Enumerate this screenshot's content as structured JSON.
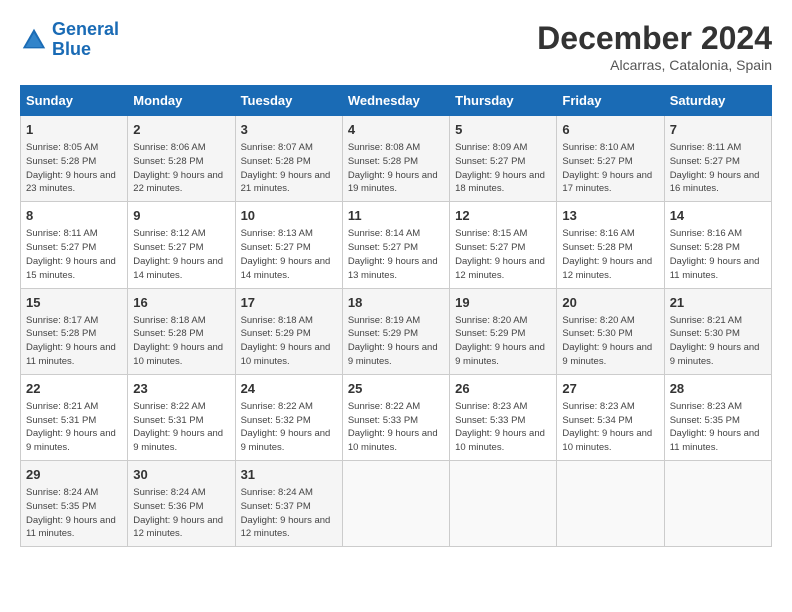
{
  "header": {
    "logo_line1": "General",
    "logo_line2": "Blue",
    "month_year": "December 2024",
    "location": "Alcarras, Catalonia, Spain"
  },
  "days_of_week": [
    "Sunday",
    "Monday",
    "Tuesday",
    "Wednesday",
    "Thursday",
    "Friday",
    "Saturday"
  ],
  "weeks": [
    [
      {
        "day": "1",
        "sunrise": "Sunrise: 8:05 AM",
        "sunset": "Sunset: 5:28 PM",
        "daylight": "Daylight: 9 hours and 23 minutes."
      },
      {
        "day": "2",
        "sunrise": "Sunrise: 8:06 AM",
        "sunset": "Sunset: 5:28 PM",
        "daylight": "Daylight: 9 hours and 22 minutes."
      },
      {
        "day": "3",
        "sunrise": "Sunrise: 8:07 AM",
        "sunset": "Sunset: 5:28 PM",
        "daylight": "Daylight: 9 hours and 21 minutes."
      },
      {
        "day": "4",
        "sunrise": "Sunrise: 8:08 AM",
        "sunset": "Sunset: 5:28 PM",
        "daylight": "Daylight: 9 hours and 19 minutes."
      },
      {
        "day": "5",
        "sunrise": "Sunrise: 8:09 AM",
        "sunset": "Sunset: 5:27 PM",
        "daylight": "Daylight: 9 hours and 18 minutes."
      },
      {
        "day": "6",
        "sunrise": "Sunrise: 8:10 AM",
        "sunset": "Sunset: 5:27 PM",
        "daylight": "Daylight: 9 hours and 17 minutes."
      },
      {
        "day": "7",
        "sunrise": "Sunrise: 8:11 AM",
        "sunset": "Sunset: 5:27 PM",
        "daylight": "Daylight: 9 hours and 16 minutes."
      }
    ],
    [
      {
        "day": "8",
        "sunrise": "Sunrise: 8:11 AM",
        "sunset": "Sunset: 5:27 PM",
        "daylight": "Daylight: 9 hours and 15 minutes."
      },
      {
        "day": "9",
        "sunrise": "Sunrise: 8:12 AM",
        "sunset": "Sunset: 5:27 PM",
        "daylight": "Daylight: 9 hours and 14 minutes."
      },
      {
        "day": "10",
        "sunrise": "Sunrise: 8:13 AM",
        "sunset": "Sunset: 5:27 PM",
        "daylight": "Daylight: 9 hours and 14 minutes."
      },
      {
        "day": "11",
        "sunrise": "Sunrise: 8:14 AM",
        "sunset": "Sunset: 5:27 PM",
        "daylight": "Daylight: 9 hours and 13 minutes."
      },
      {
        "day": "12",
        "sunrise": "Sunrise: 8:15 AM",
        "sunset": "Sunset: 5:27 PM",
        "daylight": "Daylight: 9 hours and 12 minutes."
      },
      {
        "day": "13",
        "sunrise": "Sunrise: 8:16 AM",
        "sunset": "Sunset: 5:28 PM",
        "daylight": "Daylight: 9 hours and 12 minutes."
      },
      {
        "day": "14",
        "sunrise": "Sunrise: 8:16 AM",
        "sunset": "Sunset: 5:28 PM",
        "daylight": "Daylight: 9 hours and 11 minutes."
      }
    ],
    [
      {
        "day": "15",
        "sunrise": "Sunrise: 8:17 AM",
        "sunset": "Sunset: 5:28 PM",
        "daylight": "Daylight: 9 hours and 11 minutes."
      },
      {
        "day": "16",
        "sunrise": "Sunrise: 8:18 AM",
        "sunset": "Sunset: 5:28 PM",
        "daylight": "Daylight: 9 hours and 10 minutes."
      },
      {
        "day": "17",
        "sunrise": "Sunrise: 8:18 AM",
        "sunset": "Sunset: 5:29 PM",
        "daylight": "Daylight: 9 hours and 10 minutes."
      },
      {
        "day": "18",
        "sunrise": "Sunrise: 8:19 AM",
        "sunset": "Sunset: 5:29 PM",
        "daylight": "Daylight: 9 hours and 9 minutes."
      },
      {
        "day": "19",
        "sunrise": "Sunrise: 8:20 AM",
        "sunset": "Sunset: 5:29 PM",
        "daylight": "Daylight: 9 hours and 9 minutes."
      },
      {
        "day": "20",
        "sunrise": "Sunrise: 8:20 AM",
        "sunset": "Sunset: 5:30 PM",
        "daylight": "Daylight: 9 hours and 9 minutes."
      },
      {
        "day": "21",
        "sunrise": "Sunrise: 8:21 AM",
        "sunset": "Sunset: 5:30 PM",
        "daylight": "Daylight: 9 hours and 9 minutes."
      }
    ],
    [
      {
        "day": "22",
        "sunrise": "Sunrise: 8:21 AM",
        "sunset": "Sunset: 5:31 PM",
        "daylight": "Daylight: 9 hours and 9 minutes."
      },
      {
        "day": "23",
        "sunrise": "Sunrise: 8:22 AM",
        "sunset": "Sunset: 5:31 PM",
        "daylight": "Daylight: 9 hours and 9 minutes."
      },
      {
        "day": "24",
        "sunrise": "Sunrise: 8:22 AM",
        "sunset": "Sunset: 5:32 PM",
        "daylight": "Daylight: 9 hours and 9 minutes."
      },
      {
        "day": "25",
        "sunrise": "Sunrise: 8:22 AM",
        "sunset": "Sunset: 5:33 PM",
        "daylight": "Daylight: 9 hours and 10 minutes."
      },
      {
        "day": "26",
        "sunrise": "Sunrise: 8:23 AM",
        "sunset": "Sunset: 5:33 PM",
        "daylight": "Daylight: 9 hours and 10 minutes."
      },
      {
        "day": "27",
        "sunrise": "Sunrise: 8:23 AM",
        "sunset": "Sunset: 5:34 PM",
        "daylight": "Daylight: 9 hours and 10 minutes."
      },
      {
        "day": "28",
        "sunrise": "Sunrise: 8:23 AM",
        "sunset": "Sunset: 5:35 PM",
        "daylight": "Daylight: 9 hours and 11 minutes."
      }
    ],
    [
      {
        "day": "29",
        "sunrise": "Sunrise: 8:24 AM",
        "sunset": "Sunset: 5:35 PM",
        "daylight": "Daylight: 9 hours and 11 minutes."
      },
      {
        "day": "30",
        "sunrise": "Sunrise: 8:24 AM",
        "sunset": "Sunset: 5:36 PM",
        "daylight": "Daylight: 9 hours and 12 minutes."
      },
      {
        "day": "31",
        "sunrise": "Sunrise: 8:24 AM",
        "sunset": "Sunset: 5:37 PM",
        "daylight": "Daylight: 9 hours and 12 minutes."
      },
      null,
      null,
      null,
      null
    ]
  ]
}
